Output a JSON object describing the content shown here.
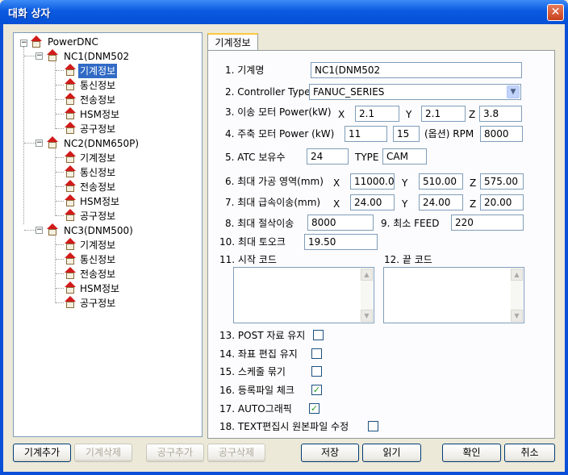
{
  "window": {
    "title": "대화 상자",
    "close_glyph": "✕"
  },
  "tree": {
    "root": "PowerDNC",
    "machines": [
      {
        "name": "NC1(DNM502",
        "children": [
          "기계정보",
          "통신정보",
          "전송정보",
          "HSM정보",
          "공구정보"
        ]
      },
      {
        "name": "NC2(DNM650P)",
        "children": [
          "기계정보",
          "통신정보",
          "전송정보",
          "HSM정보",
          "공구정보"
        ]
      },
      {
        "name": "NC3(DNM500)",
        "children": [
          "기계정보",
          "통신정보",
          "전송정보",
          "HSM정보",
          "공구정보"
        ]
      }
    ],
    "selected": "NC1(DNM502 / 기계정보"
  },
  "tab": {
    "label": "기계정보"
  },
  "form": {
    "machine_name_label": "1. 기계명",
    "machine_name": "NC1(DNM502",
    "controller_label": "2. Controller Type",
    "controller": "FANUC_SERIES",
    "move_motor_label": "3. 이송 모터 Power(kW)",
    "move_x": "2.1",
    "move_y": "2.1",
    "move_z": "3.8",
    "spindle_label": "4. 주축 모터 Power (kW)",
    "spindle_power": "11",
    "spindle_option": "15",
    "spindle_option_label": "(옵션) RPM",
    "spindle_rpm": "8000",
    "atc_label": "5. ATC 보유수",
    "atc_count": "24",
    "type_label": "TYPE",
    "type_value": "CAM",
    "range_label": "6. 최대 가공 영역(mm)",
    "range_x": "11000.0",
    "range_y": "510.00",
    "range_z": "575.00",
    "rapid_label": "7. 최대 급속이송(mm)",
    "rapid_x": "24.00",
    "rapid_y": "24.00",
    "rapid_z": "20.00",
    "cut_label": "8. 최대 절삭이송",
    "cut_value": "8000",
    "min_feed_label": "9. 최소 FEED",
    "min_feed": "220",
    "torque_label": "10. 최대 토오크",
    "torque": "19.50",
    "start_code_label": "11. 시작 코드",
    "end_code_label": "12. 끝 코드",
    "x": "X",
    "y": "Y",
    "z": "Z",
    "checks": [
      {
        "label": "13. POST 자료 유지",
        "checked": false
      },
      {
        "label": "14. 좌표 편집 유지",
        "checked": false
      },
      {
        "label": "15. 스케줄 묶기",
        "checked": false
      },
      {
        "label": "16. 등록파일 체크",
        "checked": true
      },
      {
        "label": "17. AUTO그래픽",
        "checked": true
      },
      {
        "label": "18. TEXT편집시 원본파일 수정",
        "checked": false
      }
    ]
  },
  "buttons": {
    "add_machine": "기계추가",
    "del_machine": "기계삭제",
    "add_tool": "공구추가",
    "del_tool": "공구삭제",
    "save": "저장",
    "read": "읽기",
    "ok": "확인",
    "cancel": "취소"
  }
}
